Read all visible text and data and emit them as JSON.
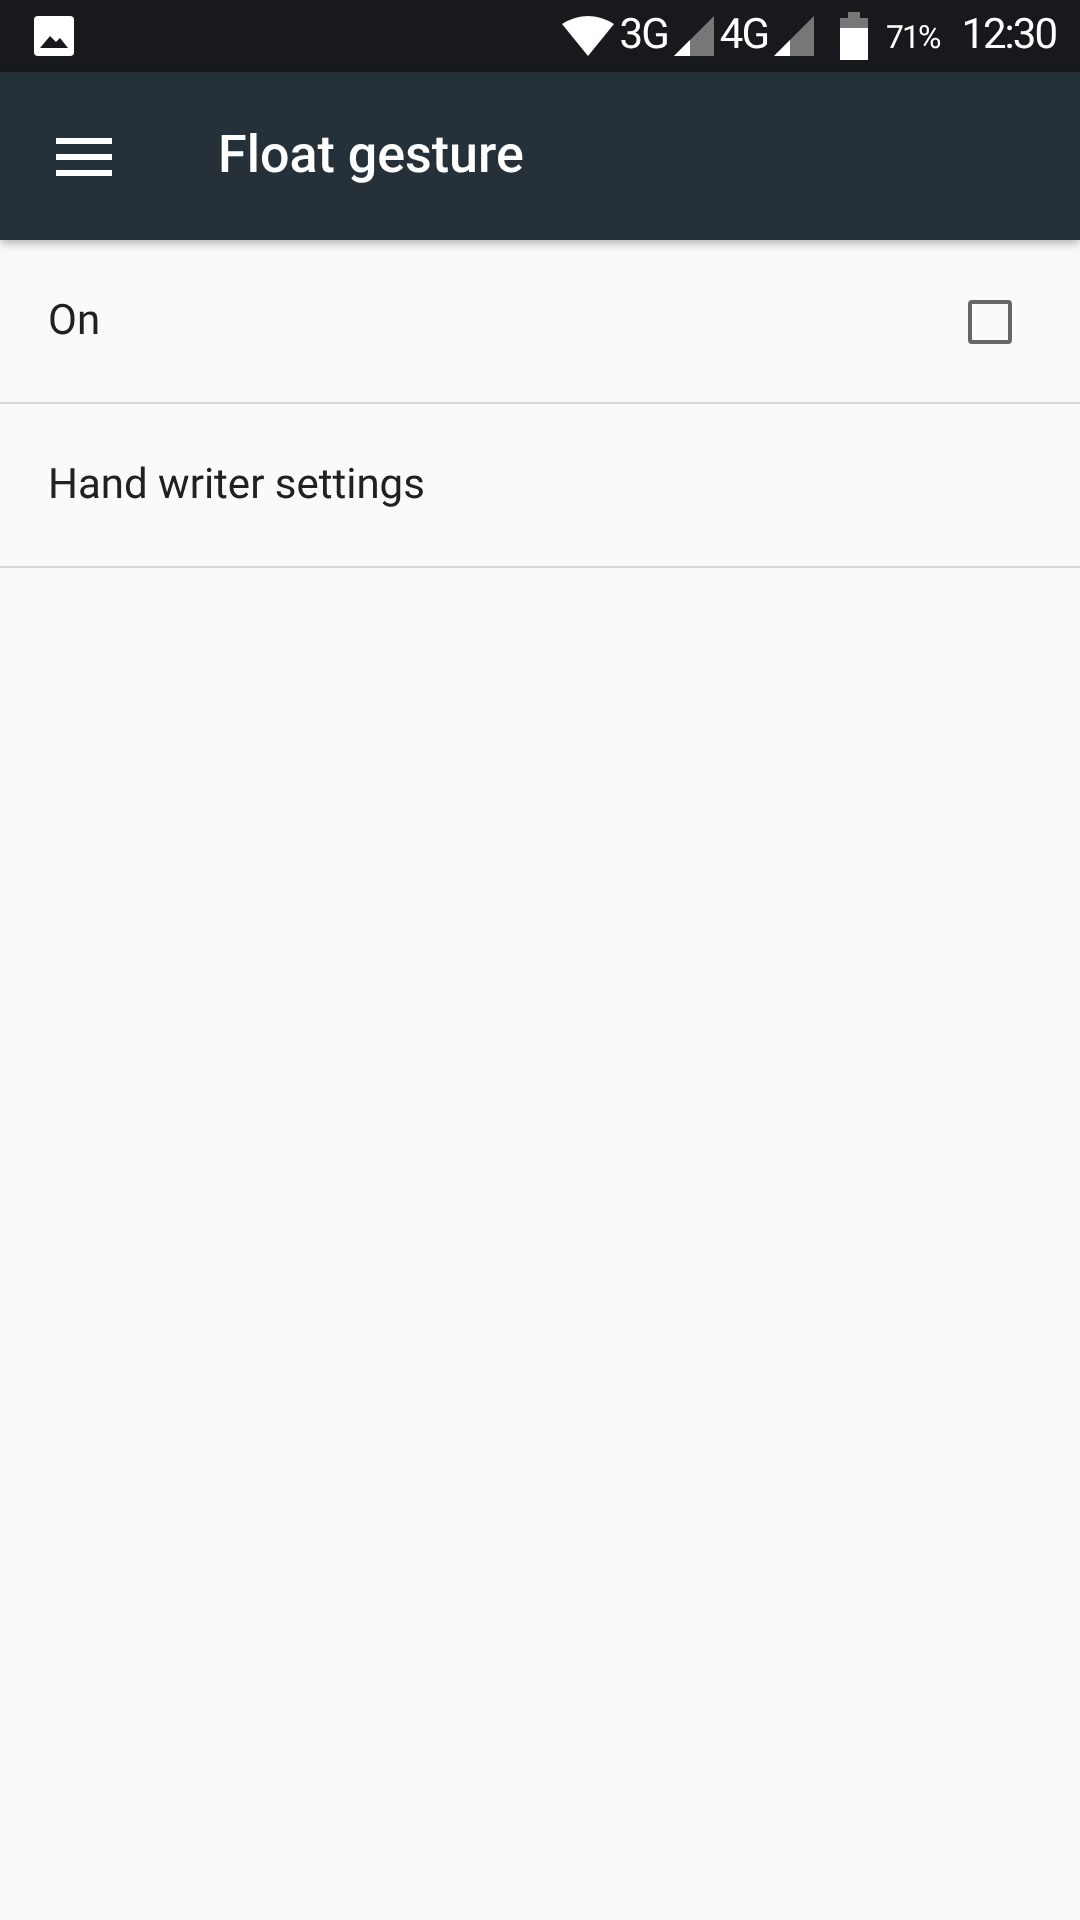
{
  "status_bar": {
    "network_1": "3G",
    "network_2": "4G",
    "battery": "71%",
    "time": "12:30"
  },
  "app_bar": {
    "title": "Float gesture"
  },
  "settings": [
    {
      "kind": "checkbox",
      "label": "On",
      "checked": false
    },
    {
      "kind": "link",
      "label": "Hand writer settings"
    }
  ]
}
